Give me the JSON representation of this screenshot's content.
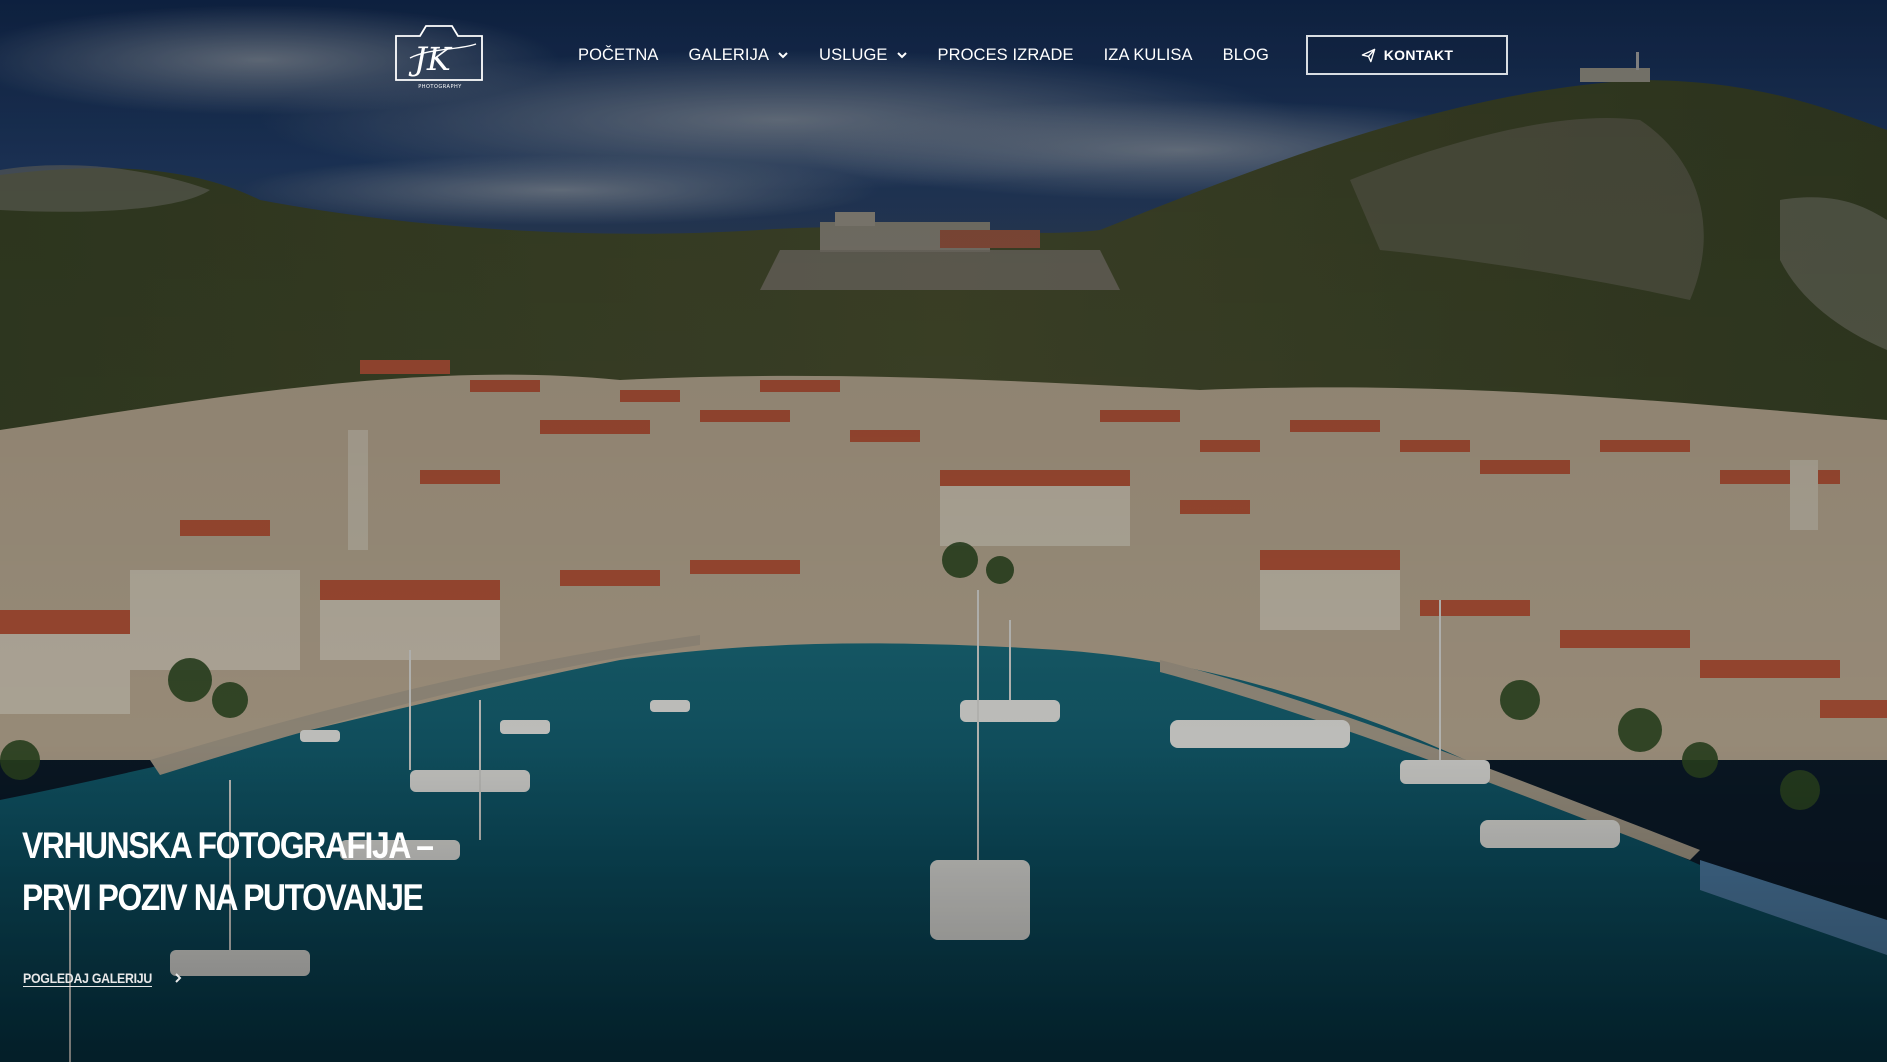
{
  "brand": {
    "logo_initials": "JK",
    "logo_tagline": "PHOTOGRAPHY",
    "logo_icon": "camera-logo-icon"
  },
  "nav": {
    "items": [
      {
        "label": "POČETNA",
        "has_dropdown": false
      },
      {
        "label": "GALERIJA",
        "has_dropdown": true
      },
      {
        "label": "USLUGE",
        "has_dropdown": true
      },
      {
        "label": "PROCES IZRADE",
        "has_dropdown": false
      },
      {
        "label": "IZA KULISA",
        "has_dropdown": false
      },
      {
        "label": "BLOG",
        "has_dropdown": false
      }
    ],
    "dropdown_icon": "chevron-down-icon"
  },
  "contact": {
    "label": "KONTAKT",
    "icon": "send-icon"
  },
  "hero": {
    "title_line1": "VRHUNSKA FOTOGRAFIJA –",
    "title_line2": "PRVI POZIV NA PUTOVANJE",
    "cta_label": "POGLEDAJ GALERIJU",
    "cta_icon": "chevron-right-icon",
    "image_subject": "aerial harbor town photo"
  },
  "colors": {
    "text": "#ffffff",
    "button_border": "#d8dde2",
    "sea": "#0f5a6e",
    "sky": "#1b3a66",
    "roofs": "#b5553a",
    "hills": "#3d4a2a"
  }
}
